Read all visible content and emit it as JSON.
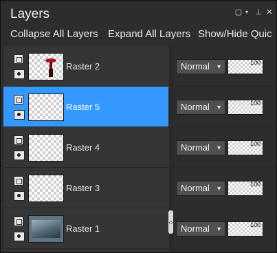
{
  "panel": {
    "title": "Layers"
  },
  "toolbar": {
    "collapse_label": "Collapse All Layers",
    "expand_label": "Expand All Layers",
    "showhide_label": "Show/Hide Quic"
  },
  "layers": [
    {
      "name": "Raster 2",
      "blend": "Normal",
      "opacity": "100",
      "selected": false
    },
    {
      "name": "Raster 5",
      "blend": "Normal",
      "opacity": "100",
      "selected": true
    },
    {
      "name": "Raster 4",
      "blend": "Normal",
      "opacity": "100",
      "selected": false
    },
    {
      "name": "Raster 3",
      "blend": "Normal",
      "opacity": "100",
      "selected": false
    },
    {
      "name": "Raster 1",
      "blend": "Normal",
      "opacity": "100",
      "selected": false
    }
  ],
  "colors": {
    "selection": "#3399ff",
    "panel_bg": "#2d2d2d"
  }
}
